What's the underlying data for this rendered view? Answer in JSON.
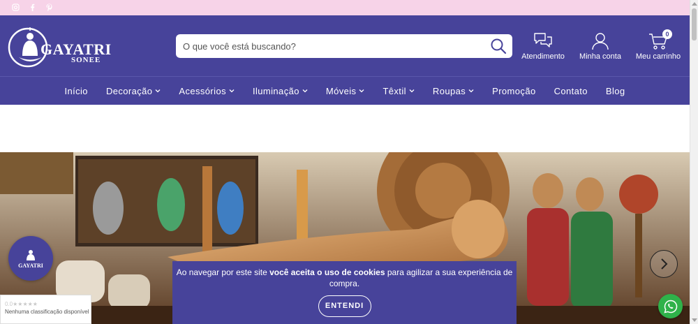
{
  "topbar": {
    "social": [
      {
        "icon": "instagram-icon",
        "glyph": "◎"
      },
      {
        "icon": "facebook-icon",
        "glyph": "f"
      },
      {
        "icon": "pinterest-icon",
        "glyph": "℗"
      }
    ]
  },
  "logo": {
    "name": "GAYATRI",
    "sub": "SONEE"
  },
  "search": {
    "placeholder": "O que você está buscando?"
  },
  "header_links": {
    "support": "Atendimento",
    "account": "Minha conta",
    "cart": "Meu carrinho",
    "cart_count": "0"
  },
  "nav": [
    {
      "label": "Início",
      "dropdown": false
    },
    {
      "label": "Decoração",
      "dropdown": true
    },
    {
      "label": "Acessórios",
      "dropdown": true
    },
    {
      "label": "Iluminação",
      "dropdown": true
    },
    {
      "label": "Móveis",
      "dropdown": true
    },
    {
      "label": "Têxtil",
      "dropdown": true
    },
    {
      "label": "Roupas",
      "dropdown": true
    },
    {
      "label": "Promoção",
      "dropdown": false
    },
    {
      "label": "Contato",
      "dropdown": false
    },
    {
      "label": "Blog",
      "dropdown": false
    }
  ],
  "chat_badge": {
    "label": "GAYATRI"
  },
  "rating": {
    "stars": "0.0★★★★★",
    "text": "Nenhuma classificação disponível"
  },
  "cookie": {
    "pre": "Ao navegar por este site ",
    "bold": "você aceita o uso de cookies",
    "post": " para agilizar a sua experiência de compra.",
    "button": "ENTENDI"
  },
  "colors": {
    "brand": "#47439a",
    "topbar": "#f7d3e8",
    "whatsapp": "#2fb24a"
  }
}
